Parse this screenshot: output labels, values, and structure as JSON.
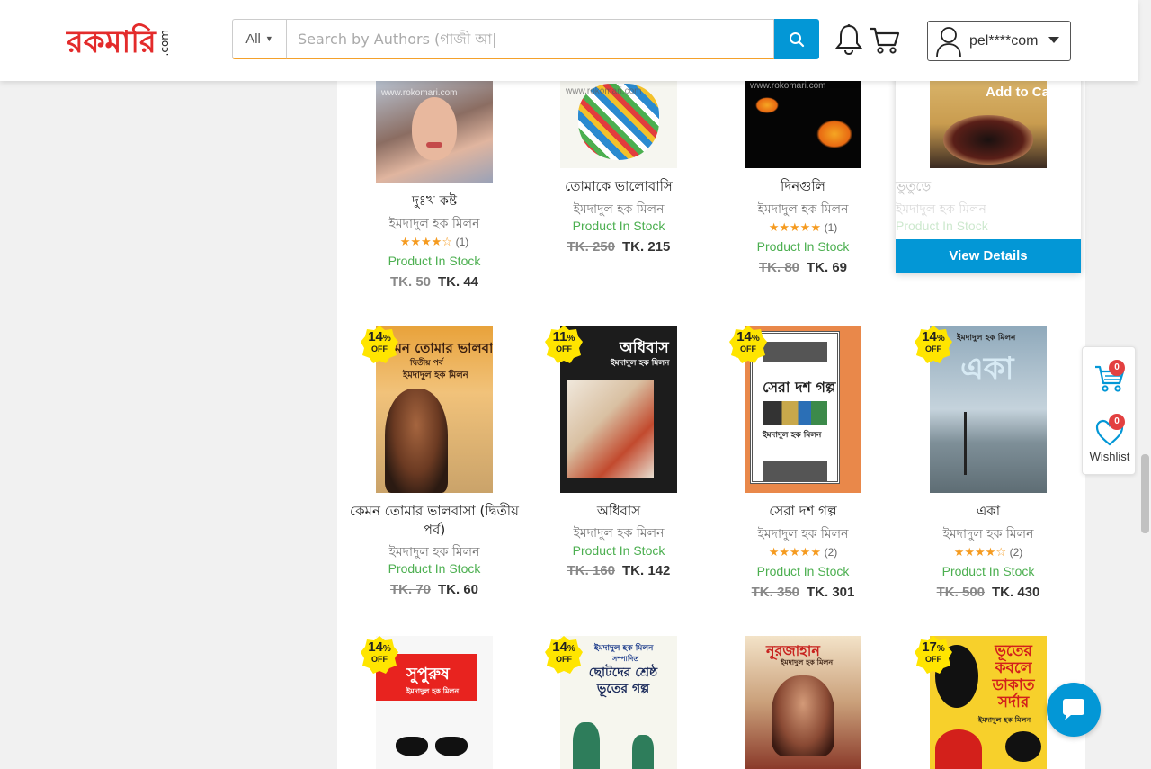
{
  "header": {
    "logo_part1": "রকমারি",
    "logo_part2": ".com",
    "search_category": "All",
    "search_placeholder": "Search by Authors (গাজী আ|",
    "user_name": "pel****com"
  },
  "badge_off_label": "OFF",
  "stock_label": "Product In Stock",
  "products": [
    {
      "title": "দুঃখ কষ্ট",
      "author": "ইমদাদুল হক মিলন",
      "stars": 4,
      "rating_count": "(1)",
      "old_price": "TK. 50",
      "price": "TK. 44",
      "discount": ""
    },
    {
      "title": "তোমাকে ভালোবাসি",
      "author": "ইমদাদুল হক মিলন",
      "stars": 0,
      "rating_count": "",
      "old_price": "TK. 250",
      "price": "TK. 215",
      "discount": ""
    },
    {
      "title": "দিনগুলি",
      "author": "ইমদাদুল হক মিলন",
      "stars": 5,
      "rating_count": "(1)",
      "old_price": "TK. 80",
      "price": "TK. 69",
      "discount": ""
    },
    {
      "title": "ভুতুড়ে",
      "author": "ইমদাদুল হক মিলন",
      "stars": 0,
      "rating_count": "",
      "old_price": "",
      "price": "",
      "discount": "",
      "add_to_cart_label": "Add to Cart",
      "view_details_label": "View  Details"
    },
    {
      "title": "কেমন তোমার ভালবাসা (দ্বিতীয় পর্ব)",
      "author": "ইমদাদুল হক মিলন",
      "stars": 0,
      "rating_count": "",
      "old_price": "TK. 70",
      "price": "TK. 60",
      "discount": "14",
      "cover_text": "কেমন তোমার ভালবাসা",
      "cover_sub": "দ্বিতীয় পর্ব",
      "cover_author": "ইমদাদুল হক মিলন"
    },
    {
      "title": "অধিবাস",
      "author": "ইমদাদুল হক মিলন",
      "stars": 0,
      "rating_count": "",
      "old_price": "TK. 160",
      "price": "TK. 142",
      "discount": "11",
      "cover_text": "অধিবাস",
      "cover_author": "ইমদাদুল হক মিলন"
    },
    {
      "title": "সেরা দশ গল্প",
      "author": "ইমদাদুল হক মিলন",
      "stars": 5,
      "rating_count": "(2)",
      "old_price": "TK. 350",
      "price": "TK. 301",
      "discount": "14",
      "cover_text": "সেরা দশ গল্প",
      "cover_author": "ইমদাদুল হক মিলন"
    },
    {
      "title": "একা",
      "author": "ইমদাদুল হক মিলন",
      "stars": 4,
      "rating_count": "(2)",
      "old_price": "TK. 500",
      "price": "TK. 430",
      "discount": "14",
      "cover_text": "একা",
      "cover_author": "ইমদাদুল হক মিলন"
    },
    {
      "discount": "14",
      "cover_text": "সুপুরুষ",
      "cover_author": "ইমদাদুল হক মিলন"
    },
    {
      "discount": "14",
      "cover_text": "ছোটদের শ্রেষ্ঠ ভূতের গল্প",
      "cover_author": "ইমদাদুল হক মিলন",
      "cover_sub": "সম্পাদিত"
    },
    {
      "discount": "",
      "cover_text": "নূরজাহান",
      "cover_author": "ইমদাদুল হক মিলন"
    },
    {
      "discount": "17",
      "cover_text": "ভূতের কবলে ডাকাত সর্দার",
      "cover_author": "ইমদাদুল হক মিলন"
    }
  ],
  "widget": {
    "cart_count": "0",
    "wishlist_count": "0",
    "wishlist_label": "Wishlist"
  },
  "watermark": "www.rokomari.com",
  "colors": {
    "accent": "#0397d6",
    "stock_green": "#4caf50",
    "star": "#f59b20",
    "badge_yellow": "#ffe500",
    "search_border": "#f4a12b"
  }
}
